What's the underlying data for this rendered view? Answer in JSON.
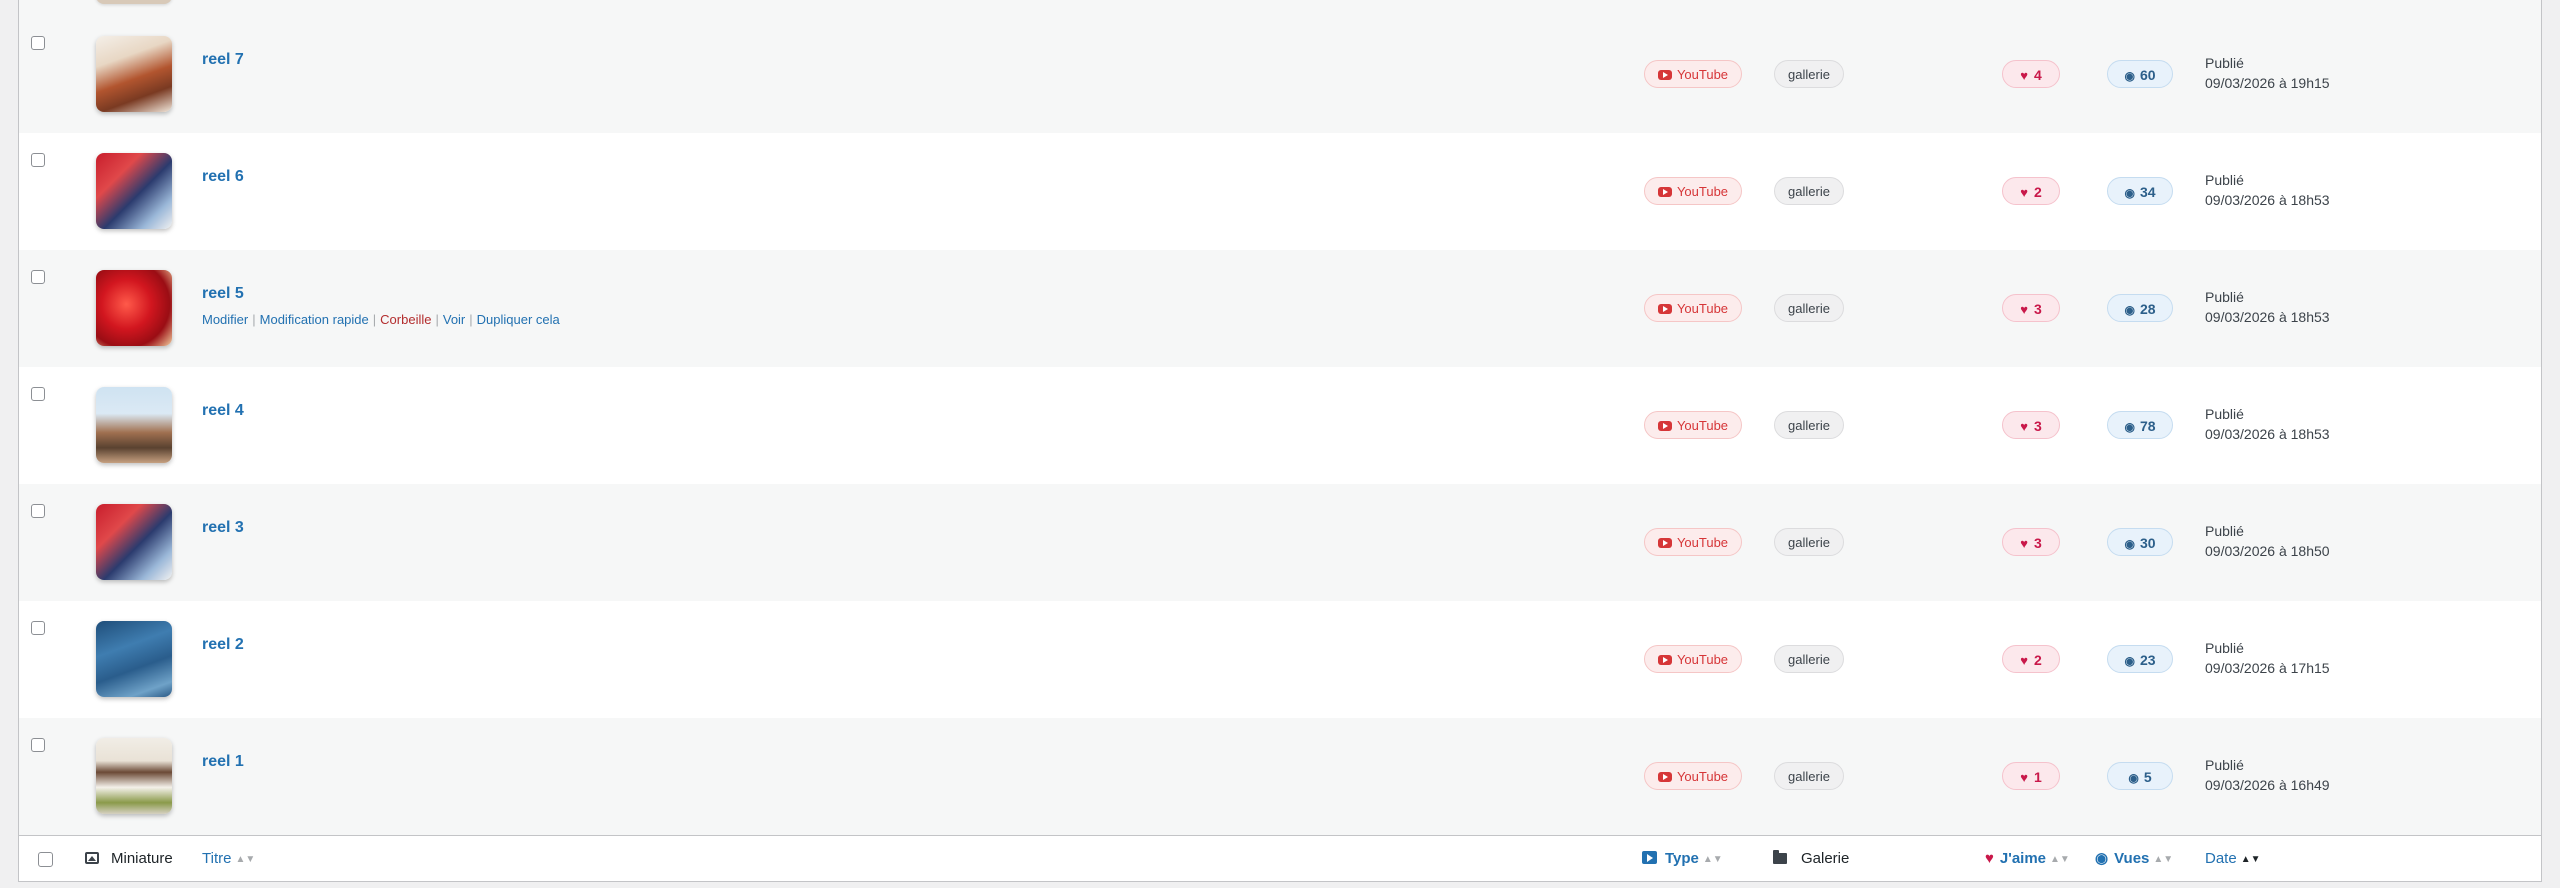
{
  "rows": [
    {
      "title": "reel 7",
      "type": "YouTube",
      "gallery": "gallerie",
      "likes": "4",
      "views": "60",
      "status": "Publié",
      "date": "09/03/2026 à 19h15"
    },
    {
      "title": "reel 6",
      "type": "YouTube",
      "gallery": "gallerie",
      "likes": "2",
      "views": "34",
      "status": "Publié",
      "date": "09/03/2026 à 18h53"
    },
    {
      "title": "reel 5",
      "type": "YouTube",
      "gallery": "gallerie",
      "likes": "3",
      "views": "28",
      "status": "Publié",
      "date": "09/03/2026 à 18h53"
    },
    {
      "title": "reel 4",
      "type": "YouTube",
      "gallery": "gallerie",
      "likes": "3",
      "views": "78",
      "status": "Publié",
      "date": "09/03/2026 à 18h53"
    },
    {
      "title": "reel 3",
      "type": "YouTube",
      "gallery": "gallerie",
      "likes": "3",
      "views": "30",
      "status": "Publié",
      "date": "09/03/2026 à 18h50"
    },
    {
      "title": "reel 2",
      "type": "YouTube",
      "gallery": "gallerie",
      "likes": "2",
      "views": "23",
      "status": "Publié",
      "date": "09/03/2026 à 17h15"
    },
    {
      "title": "reel 1",
      "type": "YouTube",
      "gallery": "gallerie",
      "likes": "1",
      "views": "5",
      "status": "Publié",
      "date": "09/03/2026 à 16h49"
    }
  ],
  "row_actions": {
    "edit": "Modifier",
    "quick_edit": "Modification rapide",
    "trash": "Corbeille",
    "view": "Voir",
    "duplicate": "Dupliquer cela",
    "separator": "|"
  },
  "footer": {
    "thumbnail": "Miniature",
    "title": "Titre",
    "type": "Type",
    "gallery": "Galerie",
    "likes": "J'aime",
    "views": "Vues",
    "date": "Date"
  },
  "colors": {
    "link": "#2271b1",
    "trash": "#b32d2e",
    "youtube": "#d63638",
    "like": "#c9184a"
  }
}
